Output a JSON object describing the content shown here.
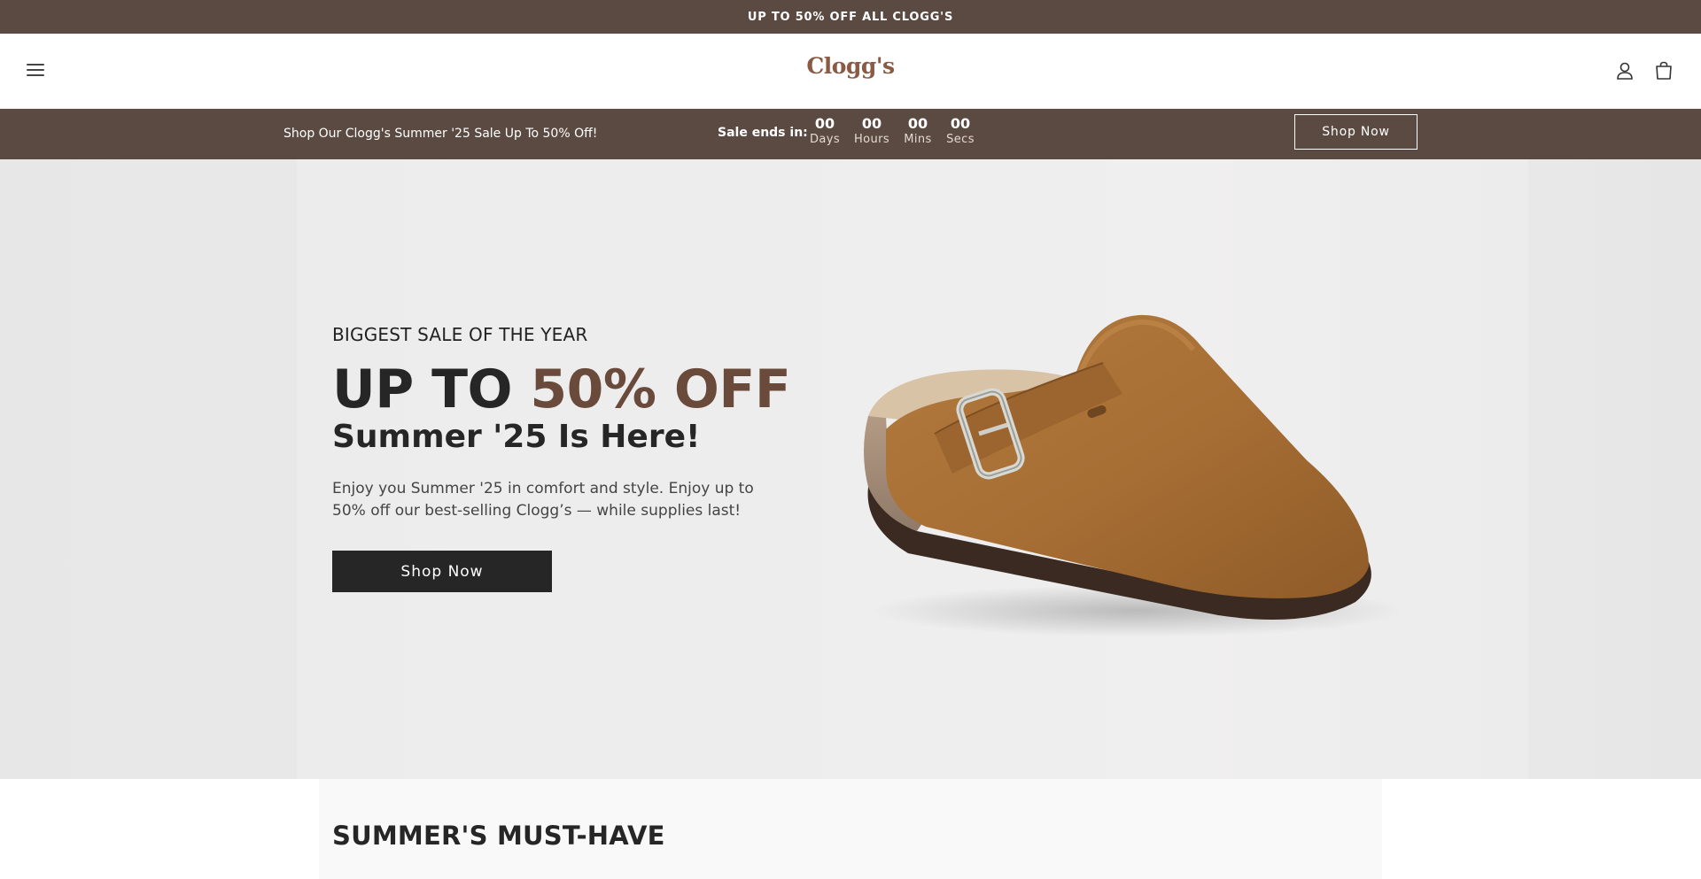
{
  "announcement": {
    "text": "UP TO 50% OFF ALL CLOGG'S"
  },
  "header": {
    "logo_text": "Clogg's",
    "menu_icon": "hamburger-menu-icon",
    "account_icon": "user-icon",
    "cart_icon": "shopping-bag-icon"
  },
  "sale_bar": {
    "promo_text": "Shop Our Clogg's Summer '25 Sale Up To 50% Off!",
    "ends_label": "Sale ends in:",
    "countdown": [
      {
        "value": "00",
        "label": "Days"
      },
      {
        "value": "00",
        "label": "Hours"
      },
      {
        "value": "00",
        "label": "Mins"
      },
      {
        "value": "00",
        "label": "Secs"
      }
    ],
    "button_label": "Shop Now"
  },
  "hero": {
    "kicker": "BIGGEST SALE OF THE YEAR",
    "headline_prefix": "UP TO ",
    "headline_accent": "50% OFF",
    "subhead": "Summer '25 Is Here!",
    "body": "Enjoy you Summer '25 in comfort and style. Enjoy up to 50% off our best-selling Clogg’s — while supplies last!",
    "button_label": "Shop Now",
    "image": "suede-clog-product-image"
  },
  "section": {
    "title": "SUMMER'S MUST-HAVE"
  },
  "colors": {
    "brand_brown": "#5b4a42",
    "accent_brown": "#6a4a3a",
    "logo_brown": "#8a5a44",
    "dark": "#262626"
  }
}
